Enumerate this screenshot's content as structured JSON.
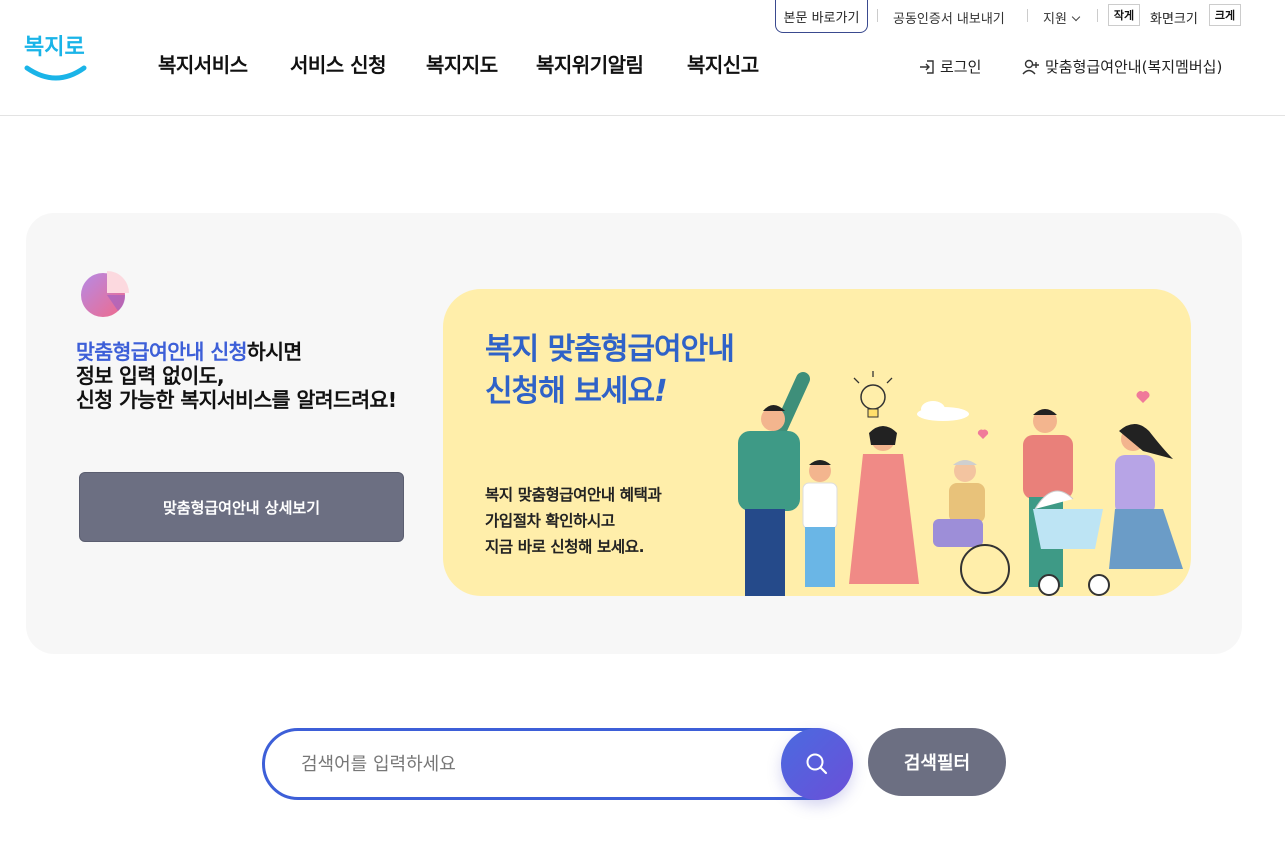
{
  "utility": {
    "skip_link": "본문 바로가기",
    "cert_export": "공동인증서 내보내기",
    "support": "지원",
    "font_small": "작게",
    "font_label": "화면크기",
    "font_large": "크게"
  },
  "header": {
    "logo_text": "복지로",
    "nav": [
      "복지서비스",
      "서비스 신청",
      "복지지도",
      "복지위기알림",
      "복지신고"
    ],
    "login": "로그인",
    "membership": "맞춤형급여안내(복지멤버십)"
  },
  "promo": {
    "highlight": "맞춤형급여안내 신청",
    "line1_rest": "하시면",
    "line2": "정보 입력 없이도,",
    "line3": "신청 가능한 복지서비스를 알려드려요!",
    "detail_button": "맞춤형급여안내 상세보기"
  },
  "banner": {
    "title_line1": "복지 맞춤형급여안내",
    "title_line2": "신청해 보세요",
    "title_exclaim": "!",
    "text_line1": "복지 맞춤형급여안내 혜택과",
    "text_line2": "가입절차 확인하시고",
    "text_line3": "지금 바로 신청해 보세요."
  },
  "search": {
    "placeholder": "검색어를 입력하세요",
    "value": "",
    "filter_button": "검색필터"
  },
  "colors": {
    "brand_blue": "#3d5fd8",
    "logo_cyan": "#1ab4e8",
    "button_gray": "#6c6f82",
    "banner_yellow": "#ffeeaa"
  }
}
